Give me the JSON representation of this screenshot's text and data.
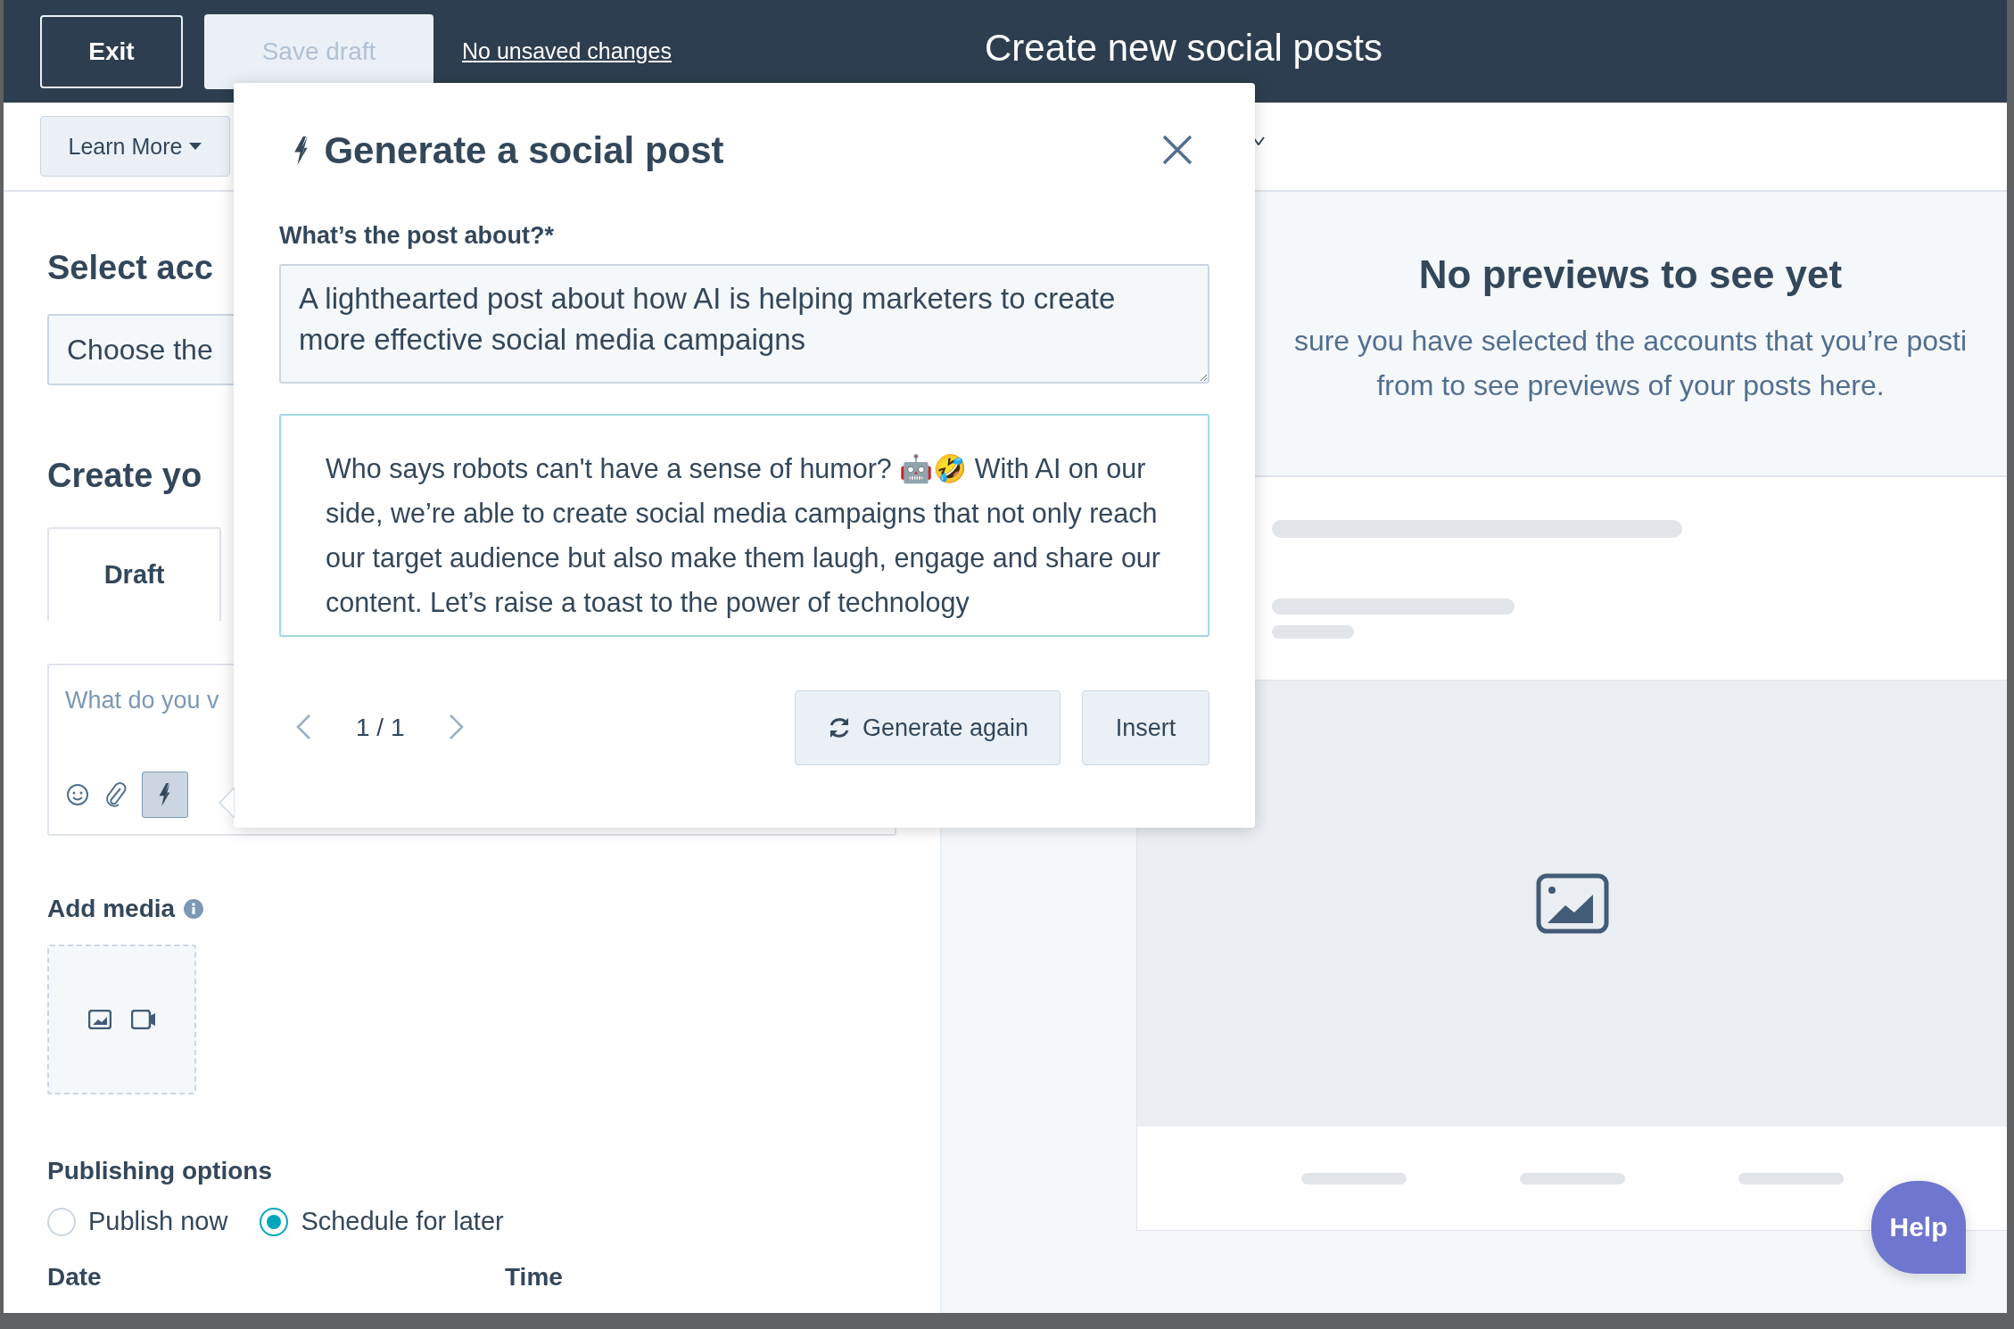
{
  "top_bar": {
    "exit": "Exit",
    "save_draft": {
      "label": "Save draft",
      "disabled": true
    },
    "save_status": "No unsaved changes",
    "title": "Create new social posts"
  },
  "toolbar": {
    "learn_more": "Learn More"
  },
  "left": {
    "select_heading": "Select acc",
    "account_placeholder": "Choose the",
    "create_heading": "Create yo",
    "tabs": [
      {
        "label": "Draft",
        "selected": true
      }
    ],
    "editor_placeholder": "What do you v",
    "ai_button_active": true,
    "add_media": "Add media",
    "publishing": {
      "title": "Publishing options",
      "options": [
        {
          "label": "Publish now",
          "selected": false
        },
        {
          "label": "Schedule for later",
          "selected": true
        }
      ]
    },
    "date_label": "Date",
    "time_label": "Time"
  },
  "modal": {
    "title": "Generate a social post",
    "prompt_label": "What’s the post about?*",
    "prompt_value": "A lighthearted post about how AI is helping marketers to create more effective social media campaigns",
    "result": "Who says robots can't have a sense of humor? 🤖🤣 With AI on our side, we’re able to create social media campaigns that not only reach our target audience but also make them laugh, engage and share our content. Let’s raise a toast to the power of technology",
    "pager": "1 / 1",
    "generate": "Generate again",
    "insert": "Insert"
  },
  "preview": {
    "title": "No previews to see yet",
    "message_lines": [
      "sure you have selected the accounts that you’re posti",
      "from to see previews of your posts here."
    ]
  },
  "help": "Help"
}
